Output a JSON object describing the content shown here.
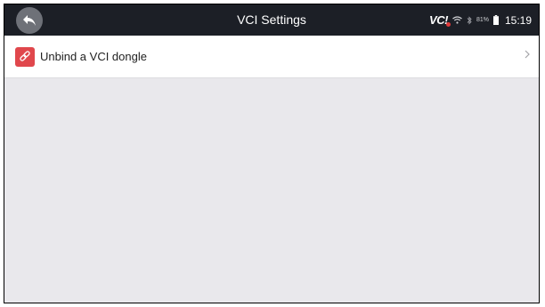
{
  "header": {
    "title": "VCI Settings",
    "vci_logo_text": "VC",
    "battery_percent": "81%",
    "time": "15:19"
  },
  "list": {
    "items": [
      {
        "label": "Unbind a VCI dongle",
        "icon": "unlink-icon"
      }
    ]
  },
  "colors": {
    "header_bg": "#1c1f26",
    "page_bg": "#e9e8ec",
    "accent_red": "#e0474c"
  }
}
